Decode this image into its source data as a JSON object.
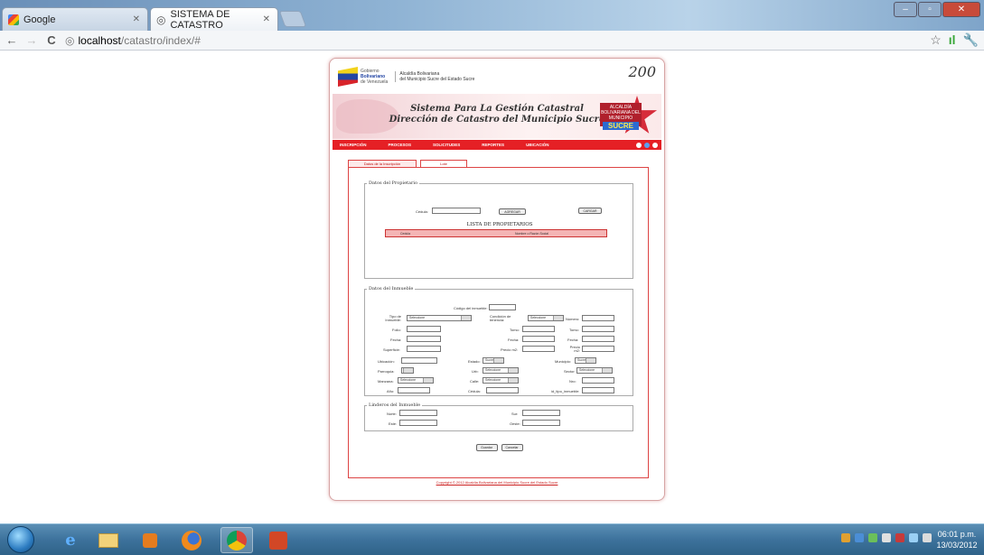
{
  "browser": {
    "tabs": [
      {
        "label": "Google",
        "active": false
      },
      {
        "label": "SISTEMA DE CATASTRO",
        "active": true
      }
    ],
    "url_host": "localhost",
    "url_path": "/catastro/index/#"
  },
  "header": {
    "gobierno_line1": "Gobierno",
    "gobierno_line2": "Bolivariano",
    "gobierno_line3": "de Venezuela",
    "alcaldia_line1": "Alcaldía Bolivariana",
    "alcaldia_line2": "del Municipio Sucre del Estado Sucre",
    "bicentenario": "200",
    "title_line1": "Sistema Para La Gestión Catastral",
    "title_line2": "Dirección de Catastro del Municipio Sucre",
    "sucre_badge_top": "ALCALDÍA BOLIVARIANA DEL MUNICIPIO",
    "sucre_badge_name": "SUCRE"
  },
  "menu": [
    "INSCRIPCIÓN",
    "PROCESOS",
    "SOLICITUDES",
    "REPORTES",
    "UBICACIÓN"
  ],
  "form_tabs": [
    "Datos de la Inscripción",
    "Lote"
  ],
  "propietario": {
    "legend": "Datos del Propietario",
    "cedula_label": "Cédula:",
    "agregar_btn": "AGREGAR",
    "cargar_btn": "CARGAR",
    "list_title": "LISTA DE PROPIETARIOS",
    "col_cedula": "Cedula",
    "col_nombre": "Nombre o Razón Social"
  },
  "inmueble": {
    "legend": "Datos del Inmueble",
    "codigo_label": "Código del inmueble:",
    "tipo_label": "Tipo de Inmueble:",
    "tipo_value": "Seleccione",
    "condicion_label": "Condición de tenencia:",
    "condicion_value": "Seleccione",
    "numero_label": "Número:",
    "folio_label": "Folio:",
    "tomo_label": "Tomo:",
    "tomo2_label": "Tomo:",
    "fecha_label": "Fecha:",
    "fecha2_label": "Fecha:",
    "fecha3_label": "Fecha:",
    "superficie_label": "Superficie:",
    "precio_label": "Precio m2:",
    "precio2_label": "Precio m2:",
    "ubicacion_label": "Ubicación:",
    "estado_label": "Estado:",
    "estado_value": "Sucre",
    "municipio_label": "Municipio:",
    "municipio_value": "Sucre",
    "parroquia_label": "Parroquia:",
    "urb_label": "Urb:",
    "urb_value": "Seleccione",
    "sector_label": "Sector:",
    "sector_value": "Seleccione",
    "manzana_label": "Manzana:",
    "manzana_value": "Seleccione",
    "calle_label": "Calle:",
    "calle_value": "Seleccione",
    "nro_label": "Nro:",
    "anio_label": "Año:",
    "cedula2_label": "Cédula:",
    "id_label": "id_tipo_inmueble:"
  },
  "linderos": {
    "legend": "Linderos del Inmueble",
    "norte_label": "Norte:",
    "sur_label": "Sur:",
    "este_label": "Este:",
    "oeste_label": "Oeste:"
  },
  "actions": {
    "guardar": "Guardar",
    "cancelar": "Cancelar"
  },
  "footer": "Copyright © 2012 Alcaldía Bolivariana del Municipio Sucre del Estado Sucre",
  "clock": {
    "time": "06:01 p.m.",
    "date": "13/03/2012"
  }
}
